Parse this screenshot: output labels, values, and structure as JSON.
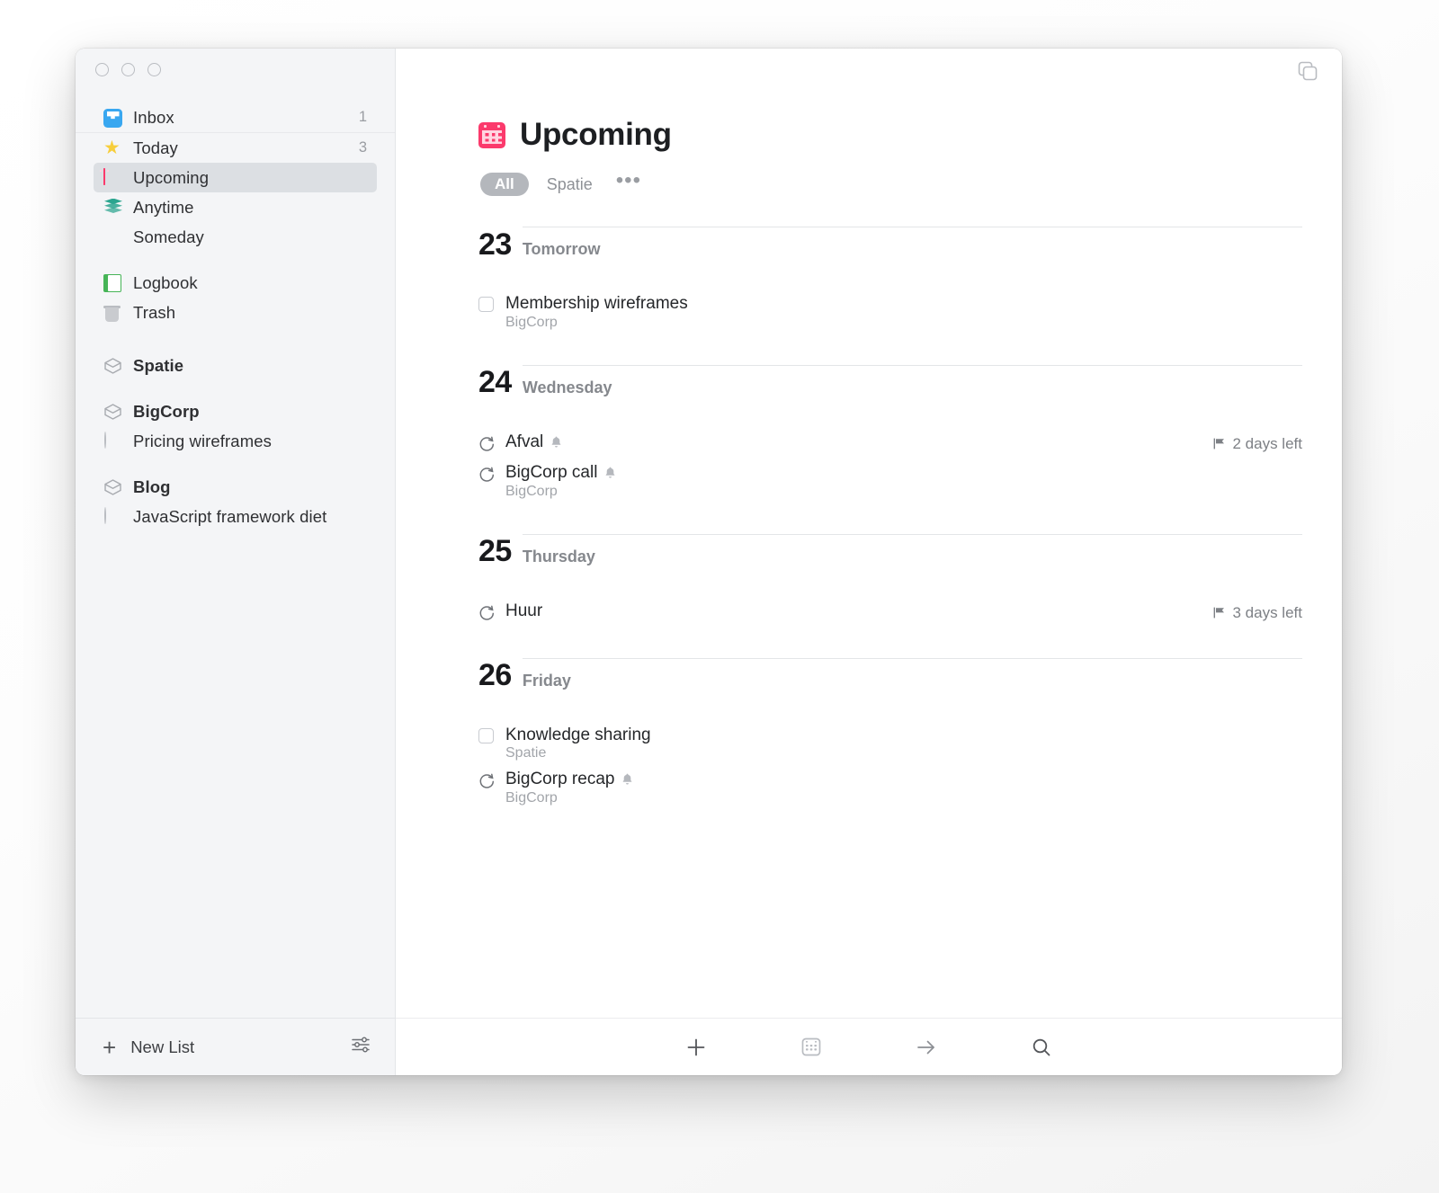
{
  "window": {
    "traffic_lights": [
      "close",
      "minimize",
      "zoom"
    ],
    "duplicate_icon": "duplicate-window-icon"
  },
  "sidebar": {
    "items": [
      {
        "icon": "inbox-icon",
        "label": "Inbox",
        "count": "1",
        "selected": false,
        "bold": false
      },
      {
        "icon": "star-icon",
        "label": "Today",
        "count": "3",
        "selected": false,
        "bold": false
      },
      {
        "icon": "calendar-icon",
        "label": "Upcoming",
        "count": "",
        "selected": true,
        "bold": false
      },
      {
        "icon": "stack-icon",
        "label": "Anytime",
        "count": "",
        "selected": false,
        "bold": false
      },
      {
        "icon": "box-icon",
        "label": "Someday",
        "count": "",
        "selected": false,
        "bold": false
      },
      {
        "icon": "logbook-icon",
        "label": "Logbook",
        "count": "",
        "selected": false,
        "bold": false
      },
      {
        "icon": "trash-icon",
        "label": "Trash",
        "count": "",
        "selected": false,
        "bold": false
      }
    ],
    "areas": [
      {
        "icon": "area-hexagon-icon",
        "label": "Spatie",
        "bold": true
      },
      {
        "icon": "area-hexagon-icon",
        "label": "BigCorp",
        "bold": true
      },
      {
        "icon": "project-circle-icon",
        "label": "Pricing wireframes",
        "bold": false
      },
      {
        "icon": "area-hexagon-icon",
        "label": "Blog",
        "bold": true
      },
      {
        "icon": "project-pie-icon",
        "label": "JavaScript framework diet",
        "bold": false
      }
    ],
    "footer": {
      "new_list_label": "New List",
      "plus_icon": "plus-icon",
      "settings_icon": "sliders-icon"
    }
  },
  "main": {
    "title": "Upcoming",
    "title_icon": "calendar-icon",
    "filters": {
      "pill_label": "All",
      "secondary_label": "Spatie",
      "more_icon": "ellipsis-icon"
    },
    "days": [
      {
        "number": "23",
        "name": "Tomorrow",
        "tasks": [
          {
            "marker": "checkbox",
            "title": "Membership wireframes",
            "subtitle": "BigCorp",
            "reminder": false,
            "deadline": ""
          }
        ]
      },
      {
        "number": "24",
        "name": "Wednesday",
        "tasks": [
          {
            "marker": "repeat",
            "title": "Afval",
            "subtitle": "",
            "reminder": true,
            "deadline": "2 days left"
          },
          {
            "marker": "repeat",
            "title": "BigCorp call",
            "subtitle": "BigCorp",
            "reminder": true,
            "deadline": ""
          }
        ]
      },
      {
        "number": "25",
        "name": "Thursday",
        "tasks": [
          {
            "marker": "repeat",
            "title": "Huur",
            "subtitle": "",
            "reminder": false,
            "deadline": "3 days left"
          }
        ]
      },
      {
        "number": "26",
        "name": "Friday",
        "tasks": [
          {
            "marker": "checkbox",
            "title": "Knowledge sharing",
            "subtitle": "Spatie",
            "reminder": false,
            "deadline": ""
          },
          {
            "marker": "repeat",
            "title": "BigCorp recap",
            "subtitle": "BigCorp",
            "reminder": true,
            "deadline": ""
          }
        ]
      }
    ],
    "footer_icons": [
      "plus-icon",
      "calendar-icon",
      "arrow-right-icon",
      "search-icon"
    ]
  },
  "colors": {
    "accent_pink": "#fb3a6c",
    "inbox_blue": "#39a7f0",
    "today_yellow": "#f7ce3c",
    "anytime_teal": "#2ba58f",
    "someday_tan": "#c6b37f",
    "logbook_green": "#46b457",
    "sidebar_bg": "#f4f5f7",
    "selected_bg": "#dcdfe3"
  }
}
